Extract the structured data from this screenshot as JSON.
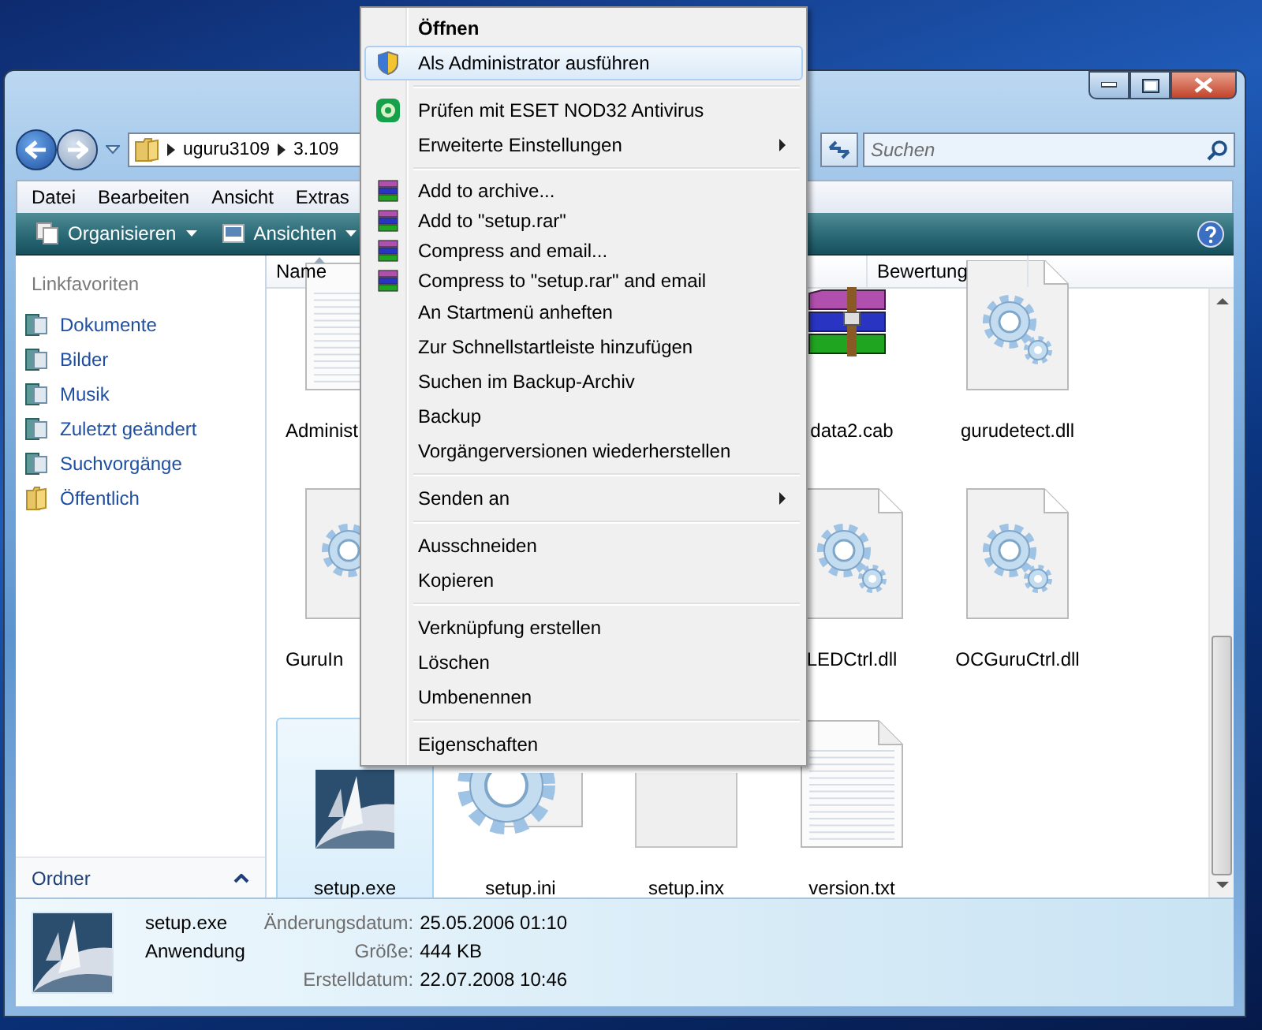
{
  "address_bar": {
    "breadcrumbs": [
      "uguru3109",
      "3.109"
    ],
    "search": {
      "placeholder": "Suchen"
    }
  },
  "menu_bar": [
    "Datei",
    "Bearbeiten",
    "Ansicht",
    "Extras"
  ],
  "toolbar": [
    {
      "label": "Organisieren"
    },
    {
      "label": "Ansichten"
    }
  ],
  "sidebar": {
    "title": "Linkfavoriten",
    "items": [
      {
        "label": "Dokumente",
        "kind": "library"
      },
      {
        "label": "Bilder",
        "kind": "library"
      },
      {
        "label": "Musik",
        "kind": "library"
      },
      {
        "label": "Zuletzt geändert",
        "kind": "library"
      },
      {
        "label": "Suchvorgänge",
        "kind": "library"
      },
      {
        "label": "Öffentlich",
        "kind": "folder"
      }
    ],
    "footer": "Ordner"
  },
  "columns": [
    "Name",
    "Bewertung"
  ],
  "file_rows": [
    [
      {
        "name": "Administ",
        "kind": "document",
        "selected": false
      },
      {
        "name": "data2.cab",
        "kind": "archive",
        "selected": false
      },
      {
        "name": "gurudetect.dll",
        "kind": "gear-page",
        "selected": false
      }
    ],
    [
      {
        "name": "GuruIn",
        "kind": "gear-page",
        "selected": false
      },
      {
        "name": "LEDCtrl.dll",
        "kind": "gear-page",
        "selected": false
      },
      {
        "name": "OCGuruCtrl.dll",
        "kind": "gear-page",
        "selected": false
      }
    ],
    [
      {
        "name": "setup.exe",
        "kind": "app",
        "selected": true
      },
      {
        "name": "setup.ini",
        "kind": "gear",
        "selected": false
      },
      {
        "name": "setup.inx",
        "kind": "blank",
        "selected": false
      },
      {
        "name": "version.txt",
        "kind": "document",
        "selected": false
      }
    ]
  ],
  "details": {
    "name": "setup.exe",
    "type": "Anwendung",
    "fields": [
      {
        "label": "Änderungsdatum:",
        "value": "25.05.2006 01:10"
      },
      {
        "label": "Größe:",
        "value": "444 KB"
      },
      {
        "label": "Erstelldatum:",
        "value": "22.07.2008 10:46"
      }
    ]
  },
  "context_menu": {
    "groups": [
      [
        {
          "label": "Öffnen",
          "kind": "plain",
          "default": true,
          "submenu": false,
          "selected": false
        },
        {
          "label": "Als Administrator ausführen",
          "kind": "shield",
          "default": false,
          "submenu": false,
          "selected": true
        }
      ],
      [
        {
          "label": "Prüfen mit ESET NOD32 Antivirus",
          "kind": "antivirus",
          "default": false,
          "submenu": false,
          "selected": false
        },
        {
          "label": "Erweiterte Einstellungen",
          "kind": "plain",
          "default": false,
          "submenu": true,
          "selected": false
        }
      ],
      [
        {
          "label": "Add to archive...",
          "kind": "archive",
          "default": false,
          "submenu": false,
          "selected": false
        },
        {
          "label": "Add to \"setup.rar\"",
          "kind": "archive",
          "default": false,
          "submenu": false,
          "selected": false
        },
        {
          "label": "Compress and email...",
          "kind": "archive",
          "default": false,
          "submenu": false,
          "selected": false
        },
        {
          "label": "Compress to \"setup.rar\" and email",
          "kind": "archive",
          "default": false,
          "submenu": false,
          "selected": false
        },
        {
          "label": "An Startmenü anheften",
          "kind": "plain",
          "default": false,
          "submenu": false,
          "selected": false
        },
        {
          "label": "Zur Schnellstartleiste hinzufügen",
          "kind": "plain",
          "default": false,
          "submenu": false,
          "selected": false
        },
        {
          "label": "Suchen im Backup-Archiv",
          "kind": "plain",
          "default": false,
          "submenu": false,
          "selected": false
        },
        {
          "label": "Backup",
          "kind": "plain",
          "default": false,
          "submenu": false,
          "selected": false
        },
        {
          "label": "Vorgängerversionen wiederherstellen",
          "kind": "plain",
          "default": false,
          "submenu": false,
          "selected": false
        }
      ],
      [
        {
          "label": "Senden an",
          "kind": "plain",
          "default": false,
          "submenu": true,
          "selected": false
        }
      ],
      [
        {
          "label": "Ausschneiden",
          "kind": "plain",
          "default": false,
          "submenu": false,
          "selected": false
        },
        {
          "label": "Kopieren",
          "kind": "plain",
          "default": false,
          "submenu": false,
          "selected": false
        }
      ],
      [
        {
          "label": "Verknüpfung erstellen",
          "kind": "plain",
          "default": false,
          "submenu": false,
          "selected": false
        },
        {
          "label": "Löschen",
          "kind": "plain",
          "default": false,
          "submenu": false,
          "selected": false
        },
        {
          "label": "Umbenennen",
          "kind": "plain",
          "default": false,
          "submenu": false,
          "selected": false
        }
      ],
      [
        {
          "label": "Eigenschaften",
          "kind": "plain",
          "default": false,
          "submenu": false,
          "selected": false
        }
      ]
    ]
  }
}
